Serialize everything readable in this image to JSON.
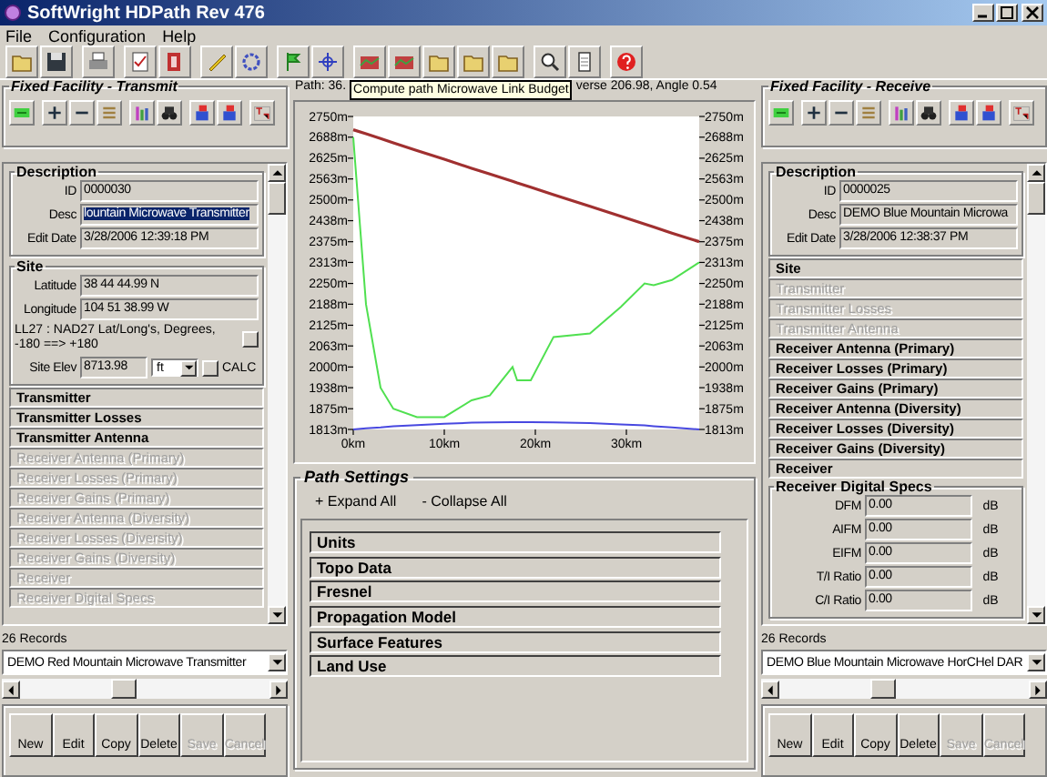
{
  "window": {
    "title": "SoftWright HDPath Rev 476"
  },
  "menu": [
    "File",
    "Configuration",
    "Help"
  ],
  "transmit": {
    "title": "Fixed Facility - Transmit",
    "groups": [
      {
        "kind": "fieldset",
        "title": "Description",
        "rows": [
          {
            "kind": "field",
            "label": "ID",
            "value": "0000030",
            "selected": false
          },
          {
            "kind": "field",
            "label": "Desc",
            "value": "lountain Microwave Transmitter",
            "selected": true
          },
          {
            "kind": "field",
            "label": "Edit Date",
            "value": "3/28/2006 12:39:18 PM",
            "selected": false
          }
        ]
      },
      {
        "kind": "fieldset",
        "title": "Site",
        "rows": [
          {
            "kind": "field",
            "label": "Latitude",
            "value": "38 44 44.99 N",
            "selected": false
          },
          {
            "kind": "field",
            "label": "Longitude",
            "value": "104 51 38.99 W",
            "selected": false
          },
          {
            "kind": "note",
            "text": "LL27 : NAD27 Lat/Long's, Degrees, -180 ==> +180"
          },
          {
            "kind": "elevation",
            "label": "Site Elev",
            "value": "8713.98",
            "unit": "ft",
            "action": "CALC"
          }
        ]
      },
      {
        "kind": "section",
        "label": "Transmitter",
        "disabled": false
      },
      {
        "kind": "section",
        "label": "Transmitter Losses",
        "disabled": false
      },
      {
        "kind": "section",
        "label": "Transmitter Antenna",
        "disabled": false
      },
      {
        "kind": "section",
        "label": "Receiver Antenna (Primary)",
        "disabled": true
      },
      {
        "kind": "section",
        "label": "Receiver Losses (Primary)",
        "disabled": true
      },
      {
        "kind": "section",
        "label": "Receiver Gains (Primary)",
        "disabled": true
      },
      {
        "kind": "section",
        "label": "Receiver Antenna (Diversity)",
        "disabled": true
      },
      {
        "kind": "section",
        "label": "Receiver Losses (Diversity)",
        "disabled": true
      },
      {
        "kind": "section",
        "label": "Receiver Gains (Diversity)",
        "disabled": true
      },
      {
        "kind": "section",
        "label": "Receiver",
        "disabled": true
      },
      {
        "kind": "section",
        "label": "Receiver Digital Specs",
        "disabled": true
      }
    ],
    "records": "26 Records",
    "record": "DEMO Red Mountain Microwave Transmitter",
    "buttons": [
      {
        "label": "New",
        "disabled": false
      },
      {
        "label": "Edit",
        "disabled": false
      },
      {
        "label": "Copy",
        "disabled": false
      },
      {
        "label": "Delete",
        "disabled": false
      },
      {
        "label": "Save",
        "disabled": true
      },
      {
        "label": "Cancel",
        "disabled": true
      }
    ]
  },
  "path": {
    "header_start": "Path: 36.",
    "tooltip": "Compute path Microwave Link Budget",
    "header_end": "verse 206.98, Angle 0.54",
    "chart_data": {
      "type": "line",
      "x": [
        0,
        1.4,
        3,
        4.4,
        7,
        10,
        13,
        15,
        17.5,
        18,
        19.5,
        22,
        26,
        29.4,
        32,
        33,
        35,
        38
      ],
      "series": [
        {
          "color": "#50e050",
          "values": [
            2688,
            2188,
            1938,
            1875,
            1850,
            1850,
            1900,
            1915,
            2000,
            1960,
            1960,
            2090,
            2100,
            2180,
            2250,
            2245,
            2260,
            2313
          ]
        },
        {
          "color": "#a03030",
          "values": [
            2710,
            2698,
            2684,
            2671,
            2648,
            2622,
            2595,
            2578,
            2556,
            2551,
            2538,
            2516,
            2481,
            2451,
            2428,
            2419,
            2401,
            2375
          ]
        },
        {
          "color": "#4848e0",
          "values": [
            1813,
            1816,
            1819,
            1822,
            1826,
            1830,
            1833,
            1834,
            1835,
            1835,
            1835,
            1834,
            1832,
            1828,
            1825,
            1823,
            1819,
            1813
          ]
        }
      ],
      "xlim": [
        0,
        38
      ],
      "ylim": [
        1813,
        2750
      ],
      "xticks": [
        {
          "value": 0,
          "label": "0km"
        },
        {
          "value": 10,
          "label": "10km"
        },
        {
          "value": 20,
          "label": "20km"
        },
        {
          "value": 30,
          "label": "30km"
        }
      ],
      "yticks": [
        {
          "value": 2750,
          "label": "2750m"
        },
        {
          "value": 2688,
          "label": "2688m"
        },
        {
          "value": 2625,
          "label": "2625m"
        },
        {
          "value": 2563,
          "label": "2563m"
        },
        {
          "value": 2500,
          "label": "2500m"
        },
        {
          "value": 2438,
          "label": "2438m"
        },
        {
          "value": 2375,
          "label": "2375m"
        },
        {
          "value": 2313,
          "label": "2313m"
        },
        {
          "value": 2250,
          "label": "2250m"
        },
        {
          "value": 2188,
          "label": "2188m"
        },
        {
          "value": 2125,
          "label": "2125m"
        },
        {
          "value": 2063,
          "label": "2063m"
        },
        {
          "value": 2000,
          "label": "2000m"
        },
        {
          "value": 1938,
          "label": "1938m"
        },
        {
          "value": 1875,
          "label": "1875m"
        },
        {
          "value": 1813,
          "label": "1813m"
        }
      ]
    }
  },
  "path_settings": {
    "title": "Path Settings",
    "expand": "+ Expand All",
    "collapse": "- Collapse All",
    "sections": [
      "Units",
      "Topo Data",
      "Fresnel",
      "Propagation Model",
      "Surface Features",
      "Land Use"
    ]
  },
  "receive": {
    "title": "Fixed Facility - Receive",
    "groups": [
      {
        "kind": "fieldset",
        "title": "Description",
        "rows": [
          {
            "kind": "field",
            "label": "ID",
            "value": "0000025",
            "selected": false
          },
          {
            "kind": "field",
            "label": "Desc",
            "value": "DEMO Blue Mountain Microwa",
            "selected": false
          },
          {
            "kind": "field",
            "label": "Edit Date",
            "value": "3/28/2006 12:38:37 PM",
            "selected": false
          }
        ]
      },
      {
        "kind": "section",
        "label": "Site",
        "disabled": false
      },
      {
        "kind": "section",
        "label": "Transmitter",
        "disabled": true
      },
      {
        "kind": "section",
        "label": "Transmitter Losses",
        "disabled": true
      },
      {
        "kind": "section",
        "label": "Transmitter Antenna",
        "disabled": true
      },
      {
        "kind": "section",
        "label": "Receiver Antenna (Primary)",
        "disabled": false
      },
      {
        "kind": "section",
        "label": "Receiver Losses (Primary)",
        "disabled": false
      },
      {
        "kind": "section",
        "label": "Receiver Gains (Primary)",
        "disabled": false
      },
      {
        "kind": "section",
        "label": "Receiver Antenna (Diversity)",
        "disabled": false
      },
      {
        "kind": "section",
        "label": "Receiver Losses (Diversity)",
        "disabled": false
      },
      {
        "kind": "section",
        "label": "Receiver Gains (Diversity)",
        "disabled": false
      },
      {
        "kind": "section",
        "label": "Receiver",
        "disabled": false
      },
      {
        "kind": "fieldset",
        "title": "Receiver Digital Specs",
        "rows": [
          {
            "kind": "field",
            "label": "DFM",
            "value": "0.00",
            "unit": "dB",
            "selected": false
          },
          {
            "kind": "field",
            "label": "AIFM",
            "value": "0.00",
            "unit": "dB",
            "selected": false
          },
          {
            "kind": "field",
            "label": "EIFM",
            "value": "0.00",
            "unit": "dB",
            "selected": false
          },
          {
            "kind": "field",
            "label": "T/I Ratio",
            "value": "0.00",
            "unit": "dB",
            "selected": false
          },
          {
            "kind": "field",
            "label": "C/I Ratio",
            "value": "0.00",
            "unit": "dB",
            "selected": false
          }
        ]
      }
    ],
    "records": "26 Records",
    "record": "DEMO Blue Mountain Microwave HorCHel DAR",
    "buttons": [
      {
        "label": "New",
        "disabled": false
      },
      {
        "label": "Edit",
        "disabled": false
      },
      {
        "label": "Copy",
        "disabled": false
      },
      {
        "label": "Delete",
        "disabled": false
      },
      {
        "label": "Save",
        "disabled": true
      },
      {
        "label": "Cancel",
        "disabled": true
      }
    ]
  }
}
